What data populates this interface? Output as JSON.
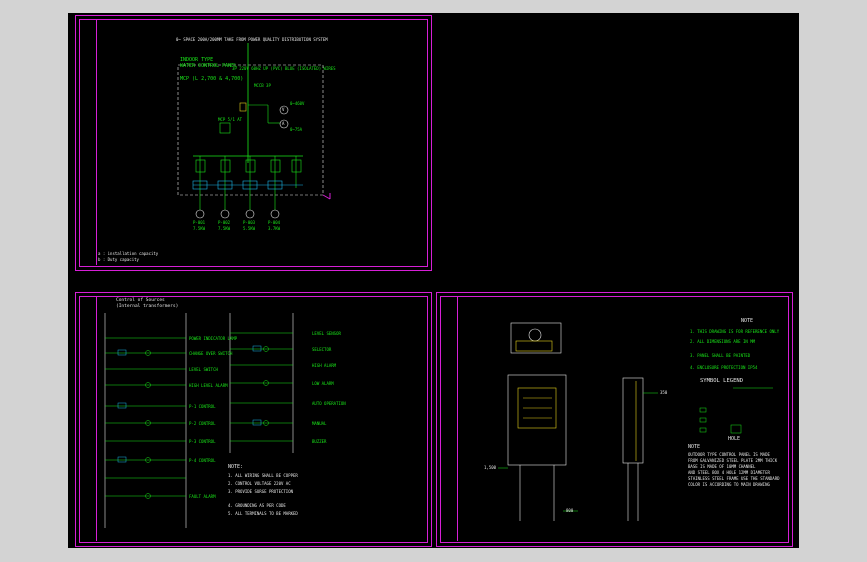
{
  "colors": {
    "background": "#000000",
    "frame": "#d61fd6",
    "wire": "#19e619",
    "equipment": "#e6d21a",
    "text": "#e6e6e6",
    "accent": "#1ab4e6"
  },
  "sheet1": {
    "top_title": "0~ SPACE 200A/200MM  TAKE FROM POWER QUALITY DISTRIBUTION SYSTEM",
    "panel_title_1": "INDOOR TYPE",
    "panel_title_2": "WATER CONTROL PANEL",
    "panel_rating": "MCP (L 2,700 & 4,700)",
    "feed_note": "3P 220V 60HZ  UP (PVC)  BLUE (ISOLATED) WIRES",
    "breaker_label": "MCCB 3P",
    "transformer_label": "MCP 5/1 AT",
    "meter_labels": [
      "V",
      "A"
    ],
    "meter_notes": [
      "0~460V",
      "0~75A"
    ],
    "feeder_labels": [
      "P-001",
      "P-002",
      "P-003",
      "P-004"
    ],
    "feeder_notes": [
      "7.5KW",
      "7.5KW",
      "5.5KW",
      "3.7KW"
    ],
    "notes": [
      "a : installation capacity",
      "b : Duty capacity"
    ]
  },
  "sheet2": {
    "title": "Control of Sources",
    "subtitle": "(Internal transformers)",
    "left_labels": [
      "POWER INDICATOR LAMP",
      "CHANGE OVER SWITCH",
      "LEVEL SWITCH",
      "HIGH LEVEL ALARM",
      "P-1 CONTROL",
      "P-2 CONTROL",
      "P-3 CONTROL",
      "P-4 CONTROL",
      "FAULT ALARM"
    ],
    "right_labels": [
      "LEVEL SENSOR",
      "SELECTOR",
      "HIGH ALARM",
      "LOW ALARM",
      "AUTO OPERATION",
      "MANUAL",
      "BUZZER"
    ],
    "notes_head": "NOTE:",
    "notes": [
      "1. ALL WIRING SHALL BE COPPER",
      "2. CONTROL VOLTAGE 220V AC",
      "3. PROVIDE SURGE PROTECTION",
      "4. GROUNDING AS PER CODE",
      "5. ALL TERMINALS TO BE MARKED"
    ]
  },
  "sheet3": {
    "title": "NOTE",
    "general_notes": [
      "1. THIS DRAWING IS FOR REFERENCE ONLY",
      "2. ALL DIMENSIONS ARE IN MM",
      "3. PANEL SHALL BE PAINTED",
      "4. ENCLOSURE PROTECTION IP54"
    ],
    "legend_title": "SYMBOL LEGEND",
    "hole_label": "HOLE",
    "bottom_title": "NOTE",
    "bottom_notes": [
      "OUTDOOR TYPE CONTROL PANEL IS MADE",
      "FROM GALVANIZED STEEL PLATE 2MM THICK",
      "BASE IS MADE OF 10MM CHANNEL",
      "AND STEEL BOX 4 HOLE 12MM DIAMETER",
      "STAINLESS STEEL FRAME USE THE STANDARD",
      "COLOR IS ACCORDING TO MAIN DRAWING"
    ],
    "dim_labels": [
      "1,500",
      "800",
      "350"
    ]
  }
}
